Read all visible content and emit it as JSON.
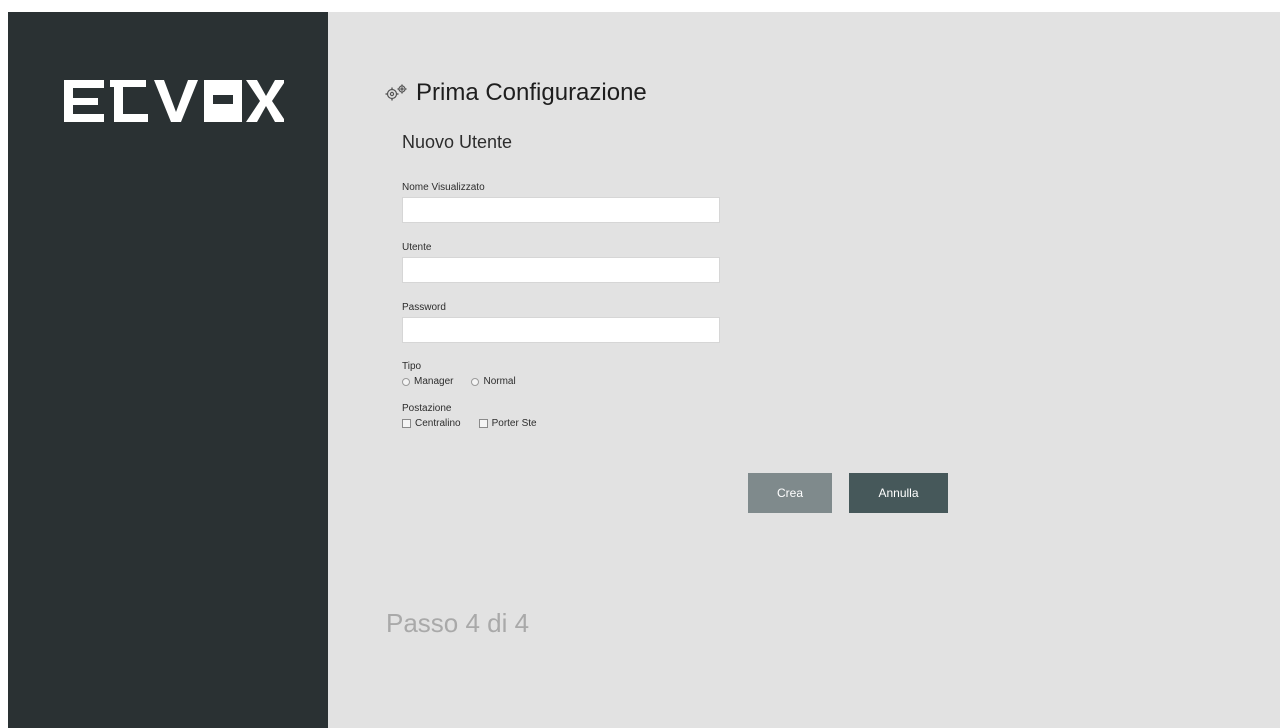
{
  "brand": {
    "logo_text": "ELVOX",
    "colors": {
      "sidebar_bg": "#2a3133",
      "content_bg": "#e2e2e2",
      "create_button_bg": "#7f8a8c",
      "cancel_button_bg": "#46585a",
      "step_text": "#a9a9a9"
    }
  },
  "header": {
    "icon": "gears-icon",
    "title": "Prima Configurazione"
  },
  "form": {
    "section_title": "Nuovo Utente",
    "display_name": {
      "label": "Nome Visualizzato",
      "value": "",
      "placeholder": ""
    },
    "username": {
      "label": "Utente",
      "value": "",
      "placeholder": ""
    },
    "password": {
      "label": "Password",
      "value": "",
      "placeholder": ""
    },
    "type": {
      "label": "Tipo",
      "options": [
        {
          "label": "Manager",
          "selected": false
        },
        {
          "label": "Normal",
          "selected": false
        }
      ]
    },
    "station": {
      "label": "Postazione",
      "options": [
        {
          "label": "Centralino",
          "checked": false
        },
        {
          "label": "Porter Ste",
          "checked": false
        }
      ]
    }
  },
  "actions": {
    "create_label": "Crea",
    "cancel_label": "Annulla"
  },
  "footer": {
    "step_text": "Passo 4 di 4"
  }
}
